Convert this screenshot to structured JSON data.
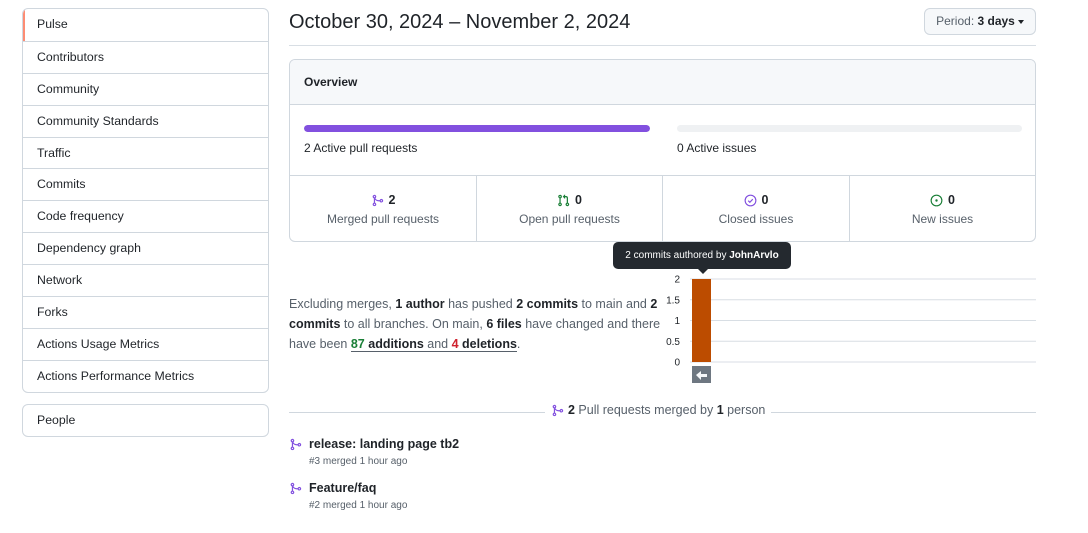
{
  "sidebar": {
    "items": [
      {
        "label": "Pulse",
        "selected": true
      },
      {
        "label": "Contributors"
      },
      {
        "label": "Community"
      },
      {
        "label": "Community Standards"
      },
      {
        "label": "Traffic"
      },
      {
        "label": "Commits"
      },
      {
        "label": "Code frequency"
      },
      {
        "label": "Dependency graph"
      },
      {
        "label": "Network"
      },
      {
        "label": "Forks"
      },
      {
        "label": "Actions Usage Metrics"
      },
      {
        "label": "Actions Performance Metrics"
      }
    ],
    "people_label": "People"
  },
  "header": {
    "date_range": "October 30, 2024 – November 2, 2024",
    "period_prefix": "Period:",
    "period_value": "3 days"
  },
  "overview": {
    "title": "Overview",
    "pr_bar_label": "2 Active pull requests",
    "pr_bar_fraction": 1.0,
    "issues_bar_label": "0 Active issues",
    "issues_bar_fraction": 0.0,
    "stats": [
      {
        "icon": "merged-pr-icon",
        "value": "2",
        "label": "Merged pull requests",
        "color": "#8250df"
      },
      {
        "icon": "open-pr-icon",
        "value": "0",
        "label": "Open pull requests",
        "color": "#1a7f37"
      },
      {
        "icon": "closed-issue-icon",
        "value": "0",
        "label": "Closed issues",
        "color": "#8250df"
      },
      {
        "icon": "new-issue-icon",
        "value": "0",
        "label": "New issues",
        "color": "#1a7f37"
      }
    ]
  },
  "summary": {
    "t1": "Excluding merges, ",
    "authors": "1 author",
    "t2": " has pushed ",
    "commits_main": "2 commits",
    "t3": " to main and ",
    "commits_all": "2 commits",
    "t4": " to all branches. On main, ",
    "files": "6 files",
    "t5": " have changed and there have been ",
    "additions_num": "87",
    "additions_word": " additions",
    "t6": " and ",
    "deletions_num": "4",
    "deletions_word": " deletions",
    "t7": "."
  },
  "chart_data": {
    "type": "bar",
    "categories": [
      "JohnArvlo"
    ],
    "values": [
      2
    ],
    "ylim": [
      0,
      2
    ],
    "yticks": [
      "2",
      "1.5",
      "1",
      "0.5",
      "0"
    ],
    "bar_color": "#bc4c00",
    "grid": true
  },
  "tooltip": {
    "prefix": "2 commits authored by ",
    "author": "JohnArvlo"
  },
  "merged_prs": {
    "count": "2",
    "mid": " Pull requests merged by ",
    "people_count": "1",
    "suffix": " person",
    "items": [
      {
        "title": "release: landing page tb2",
        "meta": "#3 merged 1 hour ago"
      },
      {
        "title": "Feature/faq",
        "meta": "#2 merged 1 hour ago"
      }
    ]
  }
}
